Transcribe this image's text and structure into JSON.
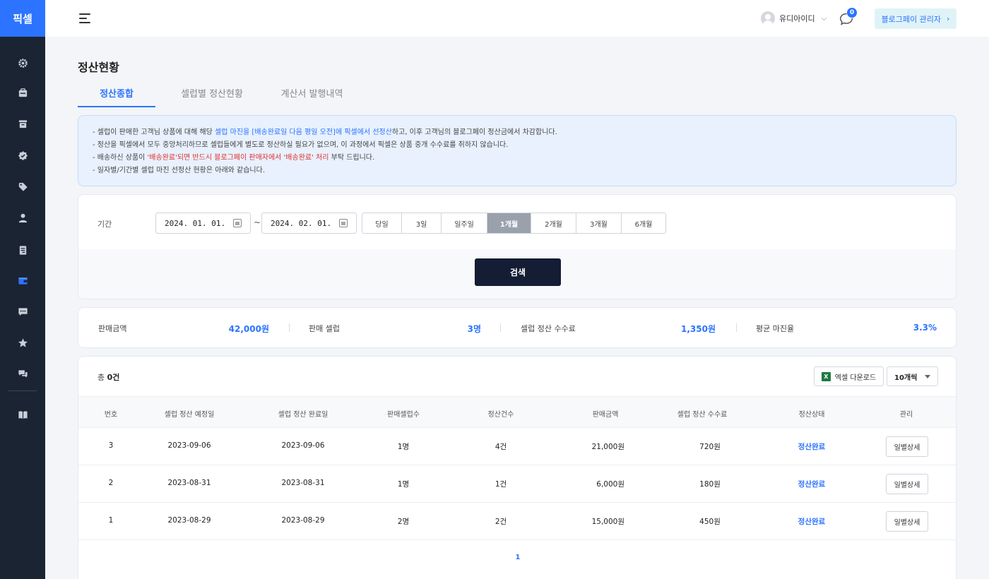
{
  "app": {
    "logo": "픽셀"
  },
  "header": {
    "user_name": "유디아이디",
    "chat_badge": "0",
    "admin_button": "블로그페이 관리자"
  },
  "page": {
    "title": "정산현황",
    "tabs": [
      {
        "label": "정산종합",
        "active": true
      },
      {
        "label": "셀럽별 정산현황",
        "active": false
      },
      {
        "label": "계산서 발행내역",
        "active": false
      }
    ]
  },
  "notice": {
    "l1_a": "- 셀럽이 판매한 고객님 상품에 대해 해당 ",
    "l1_b": "셀럽 마진을 [배송완료일 다음 평일 오전]에 픽셀에서 선정산",
    "l1_c": "하고, 이후 고객님의 블로그페이 정산금에서 차감합니다.",
    "l2": "- 정산을 픽셀에서 모두 중앙처리하므로 셀럽들에게 별도로 정산하실 필요가 없으며, 이 과정에서 픽셀은 상품 중개 수수료를 취하지 않습니다.",
    "l3_a": "- 배송하신 상품이 ",
    "l3_b": "'배송완료'되면 반드시 블로그페이 판매자에서 '배송완료' 처리",
    "l3_c": " 부탁 드립니다.",
    "l4": "- 일자별/기간별 셀럽 마진 선정산 현황은 아래와 같습니다."
  },
  "filter": {
    "label": "기간",
    "date_from": "2024. 01. 01.",
    "tilde": "~",
    "date_to": "2024. 02. 01.",
    "periods": [
      "당일",
      "3일",
      "일주일",
      "1개월",
      "2개월",
      "3개월",
      "6개월"
    ],
    "active_period": "1개월",
    "search_button": "검색"
  },
  "summary": {
    "sales_label": "판매금액",
    "sales_value": "42,000원",
    "celebs_label": "판매 셀럽",
    "celebs_value": "3명",
    "fee_label": "셀럽 정산 수수료",
    "fee_value": "1,350원",
    "margin_label": "평균 마진율",
    "margin_value": "3.3%"
  },
  "table": {
    "total_prefix": "총 ",
    "total_count": "0건",
    "excel_button": "엑셀 다운로드",
    "per_page": "10개씩",
    "columns": [
      "번호",
      "셀럽 정산 예정일",
      "셀럽 정산 완료일",
      "판매셀럽수",
      "정산건수",
      "판매금액",
      "셀럽 정산 수수료",
      "정산상태",
      "관리"
    ],
    "rows": [
      {
        "no": "3",
        "scheduled": "2023-09-06",
        "completed": "2023-09-06",
        "celebs": "1명",
        "count": "4건",
        "amount": "21,000원",
        "fee": "720원",
        "status": "정산완료",
        "action": "일별상세"
      },
      {
        "no": "2",
        "scheduled": "2023-08-31",
        "completed": "2023-08-31",
        "celebs": "1명",
        "count": "1건",
        "amount": "6,000원",
        "fee": "180원",
        "status": "정산완료",
        "action": "일별상세"
      },
      {
        "no": "1",
        "scheduled": "2023-08-29",
        "completed": "2023-08-29",
        "celebs": "2명",
        "count": "2건",
        "amount": "15,000원",
        "fee": "450원",
        "status": "정산완료",
        "action": "일별상세"
      }
    ],
    "page": "1"
  },
  "colors": {
    "accent": "#2c74ff",
    "rail": "#1b2433",
    "search_button": "#141d33",
    "warning": "#e0322f"
  }
}
